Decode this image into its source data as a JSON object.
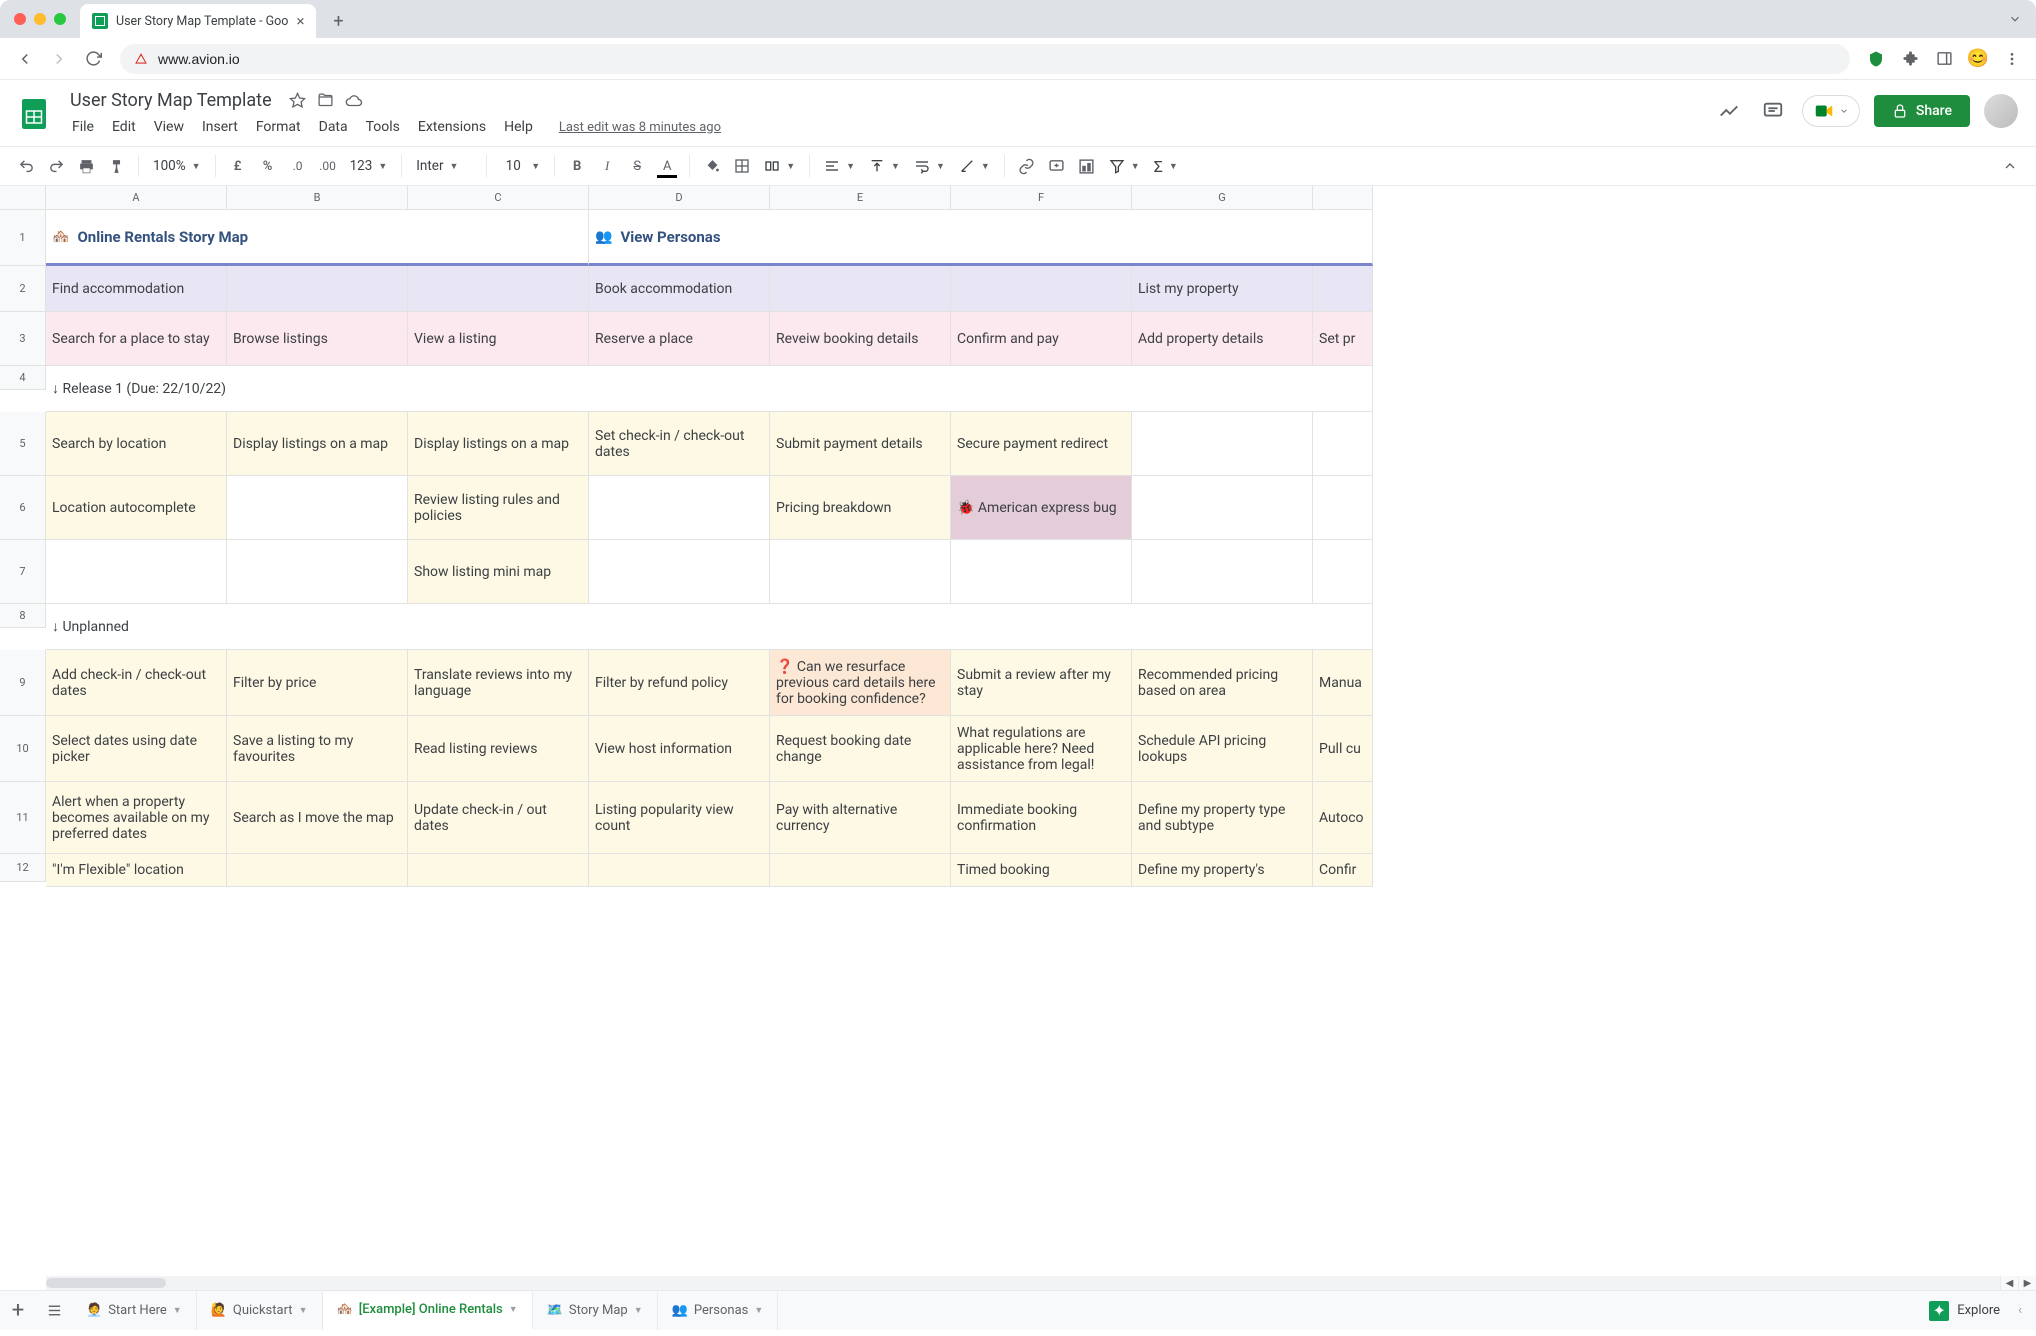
{
  "browser": {
    "tab_title": "User Story Map Template - Goo",
    "url": "www.avion.io"
  },
  "doc": {
    "title": "User Story Map Template",
    "last_edit": "Last edit was 8 minutes ago",
    "menus": [
      "File",
      "Edit",
      "View",
      "Insert",
      "Format",
      "Data",
      "Tools",
      "Extensions",
      "Help"
    ],
    "share_label": "Share"
  },
  "toolbar": {
    "zoom": "100%",
    "font": "Inter",
    "font_size": "10"
  },
  "columns": [
    "A",
    "B",
    "C",
    "D",
    "E",
    "F",
    "G",
    ""
  ],
  "rows": {
    "r1": {
      "num": "1",
      "title_emoji": "🏘️",
      "title": "Online Rentals Story Map",
      "personas_emoji": "👥",
      "personas": "View Personas"
    },
    "r2": {
      "num": "2",
      "cells": [
        "Find accommodation",
        "",
        "",
        "Book accommodation",
        "",
        "",
        "List my property",
        ""
      ]
    },
    "r3": {
      "num": "3",
      "cells": [
        "Search for a place to stay",
        "Browse listings",
        "View a listing",
        "Reserve a place",
        "Reveiw booking details",
        "Confirm and pay",
        "Add property details",
        "Set pr"
      ]
    },
    "r4": {
      "num": "4",
      "label": "↓ Release 1 (Due: 22/10/22)"
    },
    "r5": {
      "num": "5",
      "cells": [
        "Search by location",
        "Display listings on a map",
        "Display listings on a map",
        "Set check-in / check-out dates",
        "Submit payment details",
        "Secure payment redirect",
        "",
        ""
      ]
    },
    "r6": {
      "num": "6",
      "cells": [
        "Location autocomplete",
        "",
        "Review listing rules and policies",
        "",
        "Pricing breakdown",
        "🐞  American express bug",
        "",
        ""
      ]
    },
    "r7": {
      "num": "7",
      "cells": [
        "",
        "",
        "Show listing mini map",
        "",
        "",
        "",
        "",
        ""
      ]
    },
    "r8": {
      "num": "8",
      "label": "↓ Unplanned"
    },
    "r9": {
      "num": "9",
      "cells": [
        "Add check-in / check-out dates",
        "Filter by price",
        "Translate reviews into my language",
        "Filter by refund policy",
        "❓ Can we resurface previous card details here for booking confidence?",
        "Submit a review after my stay",
        "Recommended pricing based on area",
        "Manua"
      ]
    },
    "r10": {
      "num": "10",
      "cells": [
        "Select dates using date picker",
        "Save a listing to my favourites",
        "Read listing reviews",
        "View host information",
        "Request booking date change",
        "What regulations are applicable here? Need assistance from legal!",
        "Schedule API pricing lookups",
        "Pull cu"
      ]
    },
    "r11": {
      "num": "11",
      "cells": [
        "Alert when a property becomes available on my preferred dates",
        "Search as I move the map",
        "Update check-in / out dates",
        "Listing popularity view count",
        "Pay with alternative currency",
        "Immediate booking confirmation",
        "Define my property type and subtype",
        "Autoco"
      ]
    },
    "r12": {
      "num": "12",
      "cells": [
        "\"I'm Flexible\" location",
        "",
        "",
        "",
        "",
        "Timed booking",
        "Define my property's",
        "Confir"
      ]
    }
  },
  "sheet_tabs": [
    {
      "emoji": "🧑‍💼",
      "label": "Start Here"
    },
    {
      "emoji": "🙋",
      "label": "Quickstart"
    },
    {
      "emoji": "🏘️",
      "label": "[Example] Online Rentals"
    },
    {
      "emoji": "🗺️",
      "label": "Story Map"
    },
    {
      "emoji": "👥",
      "label": "Personas"
    }
  ],
  "explore_label": "Explore"
}
